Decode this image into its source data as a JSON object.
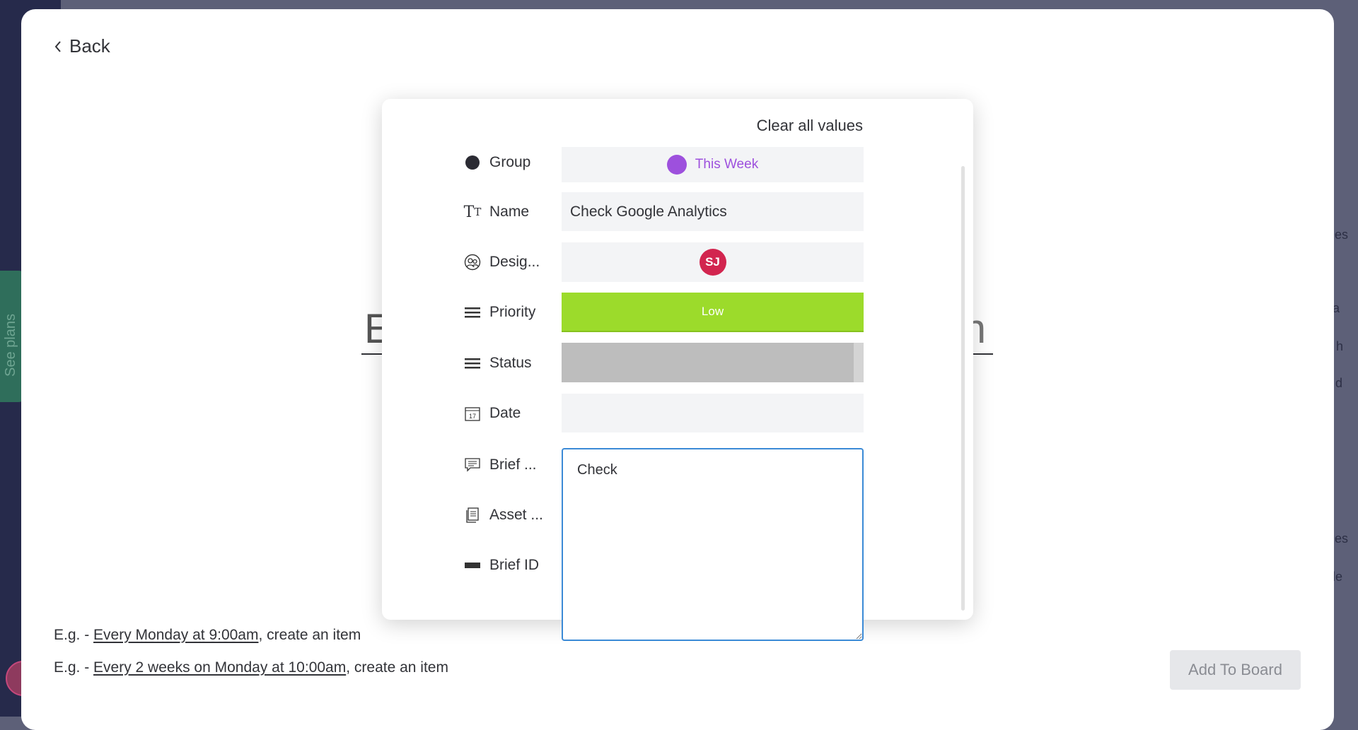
{
  "sidebar": {
    "see_plans": "See plans"
  },
  "background_right": [
    "Des",
    "ba",
    "d h",
    "y d",
    "Des",
    "ble"
  ],
  "back_label": "Back",
  "background_title": {
    "left_fragment": "E",
    "right_fragment": "n"
  },
  "examples": [
    {
      "prefix": "E.g. - ",
      "link": "Every Monday at 9:00am",
      "suffix": ", create an item"
    },
    {
      "prefix": "E.g. - ",
      "link": "Every 2 weeks on Monday at 10:00am",
      "suffix": ", create an item"
    }
  ],
  "add_to_board": "Add To Board",
  "modal": {
    "clear_all": "Clear all values",
    "fields": [
      {
        "label": "Group",
        "icon": "circle-icon",
        "value": "This Week",
        "color": "#9d50dd"
      },
      {
        "label": "Name",
        "icon": "text-type-icon",
        "value": "Check Google Analytics"
      },
      {
        "label": "Desig...",
        "icon": "people-icon",
        "value": "SJ",
        "color": "#d2254f"
      },
      {
        "label": "Priority",
        "icon": "menu-lines-icon",
        "value": "Low",
        "color": "#9cdb2b"
      },
      {
        "label": "Status",
        "icon": "menu-lines-icon",
        "value": "",
        "color": "#bdbdbd"
      },
      {
        "label": "Date",
        "icon": "calendar-icon",
        "value": ""
      },
      {
        "label": "Brief ...",
        "icon": "comment-icon",
        "value": "Check"
      },
      {
        "label": "Asset ...",
        "icon": "document-icon",
        "value": ""
      },
      {
        "label": "Brief ID",
        "icon": "id-bar-icon",
        "value": ""
      }
    ]
  }
}
